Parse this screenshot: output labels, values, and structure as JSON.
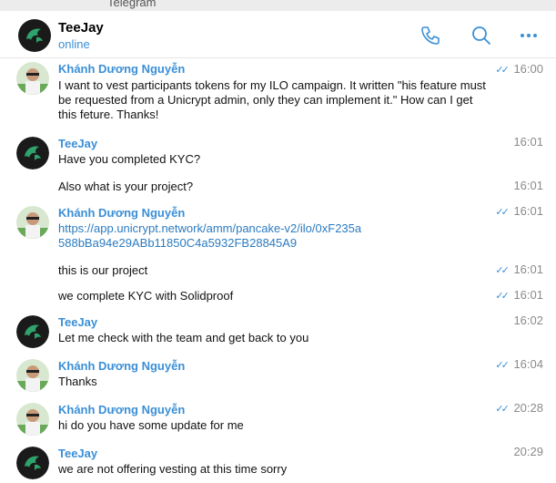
{
  "window": {
    "title": "Telegram"
  },
  "header": {
    "name": "TeeJay",
    "status": "online",
    "icons": [
      "phone-icon",
      "search-icon",
      "more-icon"
    ]
  },
  "messages": [
    {
      "sender": "Khánh Dương Nguyễn",
      "text": "I want to vest participants tokens for my ILO campaign. It written \"his feature must be requested from a Unicrypt admin, only they can implement it.\" How can I get this feture. Thanks!",
      "time": "16:00",
      "read": true
    },
    {
      "sender": "TeeJay",
      "text": "Have you completed KYC?",
      "time": "16:01",
      "read": false
    },
    {
      "sender": "",
      "text": "Also what is your project?",
      "time": "16:01",
      "read": false
    },
    {
      "sender": "Khánh Dương Nguyễn",
      "link": "https://app.unicrypt.network/amm/pancake-v2/ilo/0xF235a588bBa94e29ABb11850C4a5932FB28845A9",
      "time": "16:01",
      "read": true
    },
    {
      "sender": "",
      "text": "this is our project",
      "time": "16:01",
      "read": true
    },
    {
      "sender": "",
      "text": "we complete KYC with Solidproof",
      "time": "16:01",
      "read": true
    },
    {
      "sender": "TeeJay",
      "text": "Let me check with the team and get back to you",
      "time": "16:02",
      "read": false
    },
    {
      "sender": "Khánh Dương Nguyễn",
      "text": "Thanks",
      "time": "16:04",
      "read": true
    },
    {
      "sender": "Khánh Dương Nguyễn",
      "text": "hi do you have some update for me",
      "time": "20:28",
      "read": true
    },
    {
      "sender": "TeeJay",
      "text": "we are not offering vesting at this time sorry",
      "time": "20:29",
      "read": false
    }
  ],
  "colors": {
    "accent": "#3a8fd6",
    "link": "#2b7bc0",
    "time": "#8a8a8a"
  }
}
